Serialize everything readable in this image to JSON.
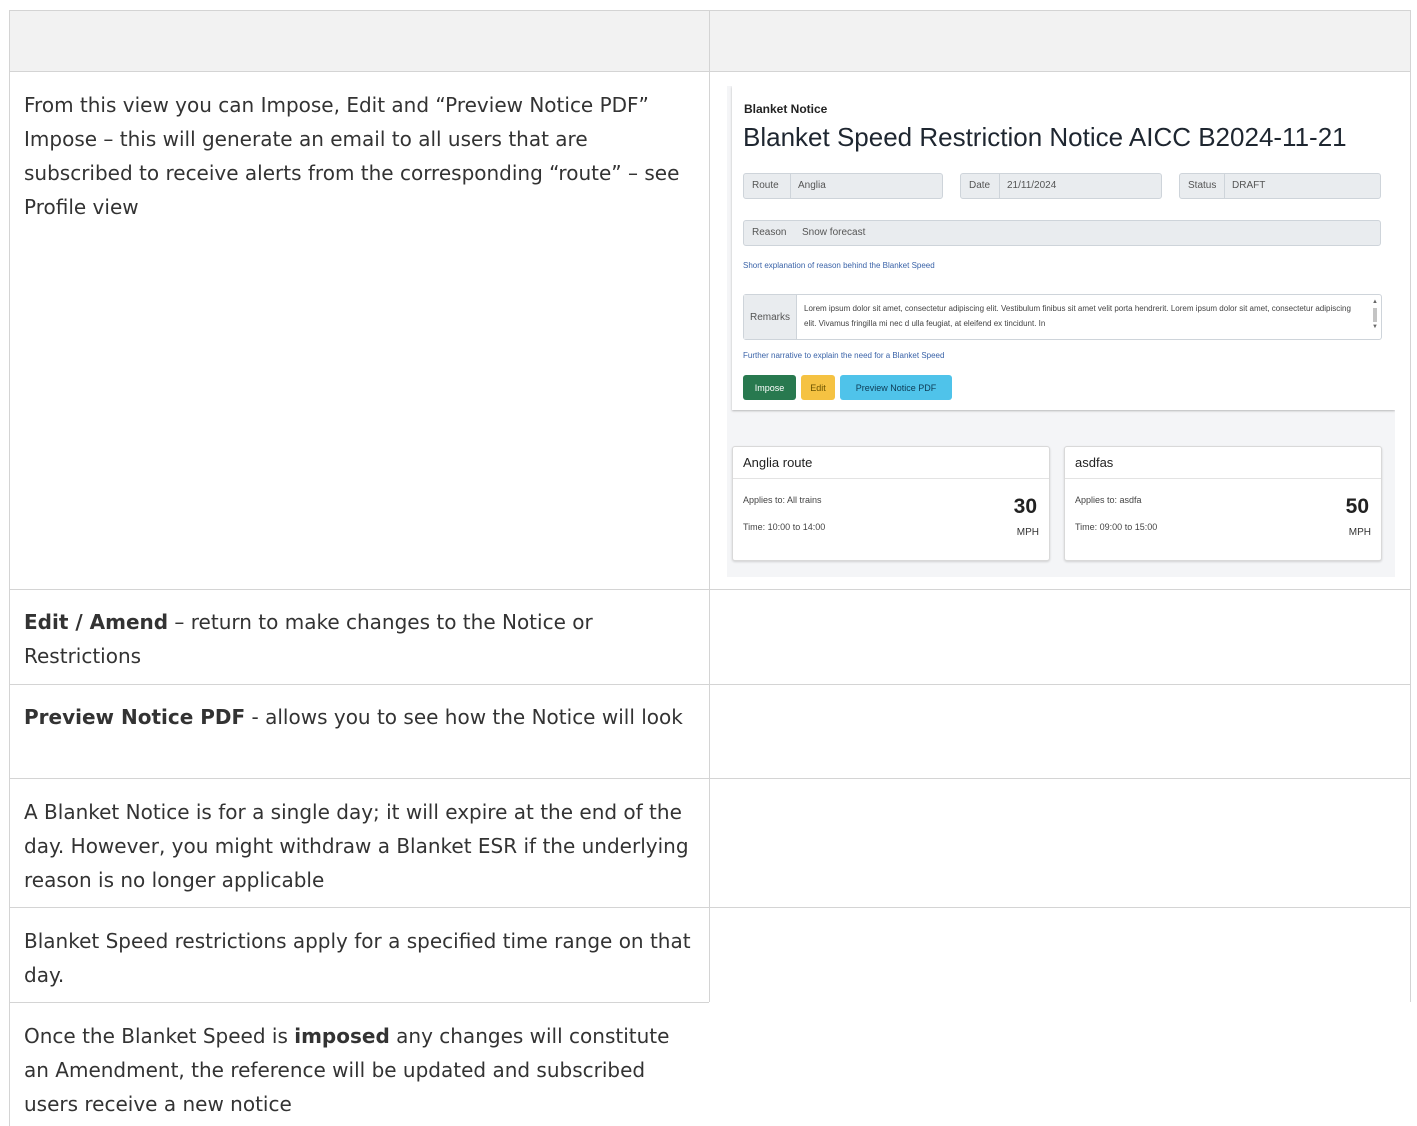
{
  "row1": {
    "text": "From this view you can Impose, Edit and “Preview Notice PDF” Impose – this will generate an email to all users that are subscribed to receive alerts from the corresponding “route” – see Profile view"
  },
  "row2": {
    "bold": "Edit / Amend",
    "rest": " – return to make changes to the Notice or Restrictions"
  },
  "row3": {
    "bold": "Preview Notice PDF",
    "rest": " - allows you to see how the Notice will look"
  },
  "row4": {
    "text": "A Blanket Notice is for a single day; it will expire at the end of the day. However, you might withdraw a Blanket ESR if the underlying reason is no longer applicable"
  },
  "row5": {
    "text": "Blanket Speed restrictions apply for a specified time range on that day."
  },
  "row6": {
    "pre": "Once the Blanket Speed is ",
    "bold": "imposed",
    "post": " any changes will constitute an Amendment, the reference will be updated and subscribed users receive a new notice"
  },
  "screenshot": {
    "breadcrumb": "Blanket Notice",
    "title": "Blanket Speed Restriction Notice AICC B2024-11-21",
    "route_label": "Route",
    "route_value": "Anglia",
    "date_label": "Date",
    "date_value": "21/11/2024",
    "status_label": "Status",
    "status_value": "DRAFT",
    "reason_label": "Reason",
    "reason_value": "Snow forecast",
    "reason_hint": "Short explanation of reason behind the Blanket Speed",
    "remarks_label": "Remarks",
    "remarks_text": "Lorem ipsum dolor sit amet, consectetur adipiscing elit. Vestibulum finibus sit amet velit porta hendrerit. Lorem ipsum dolor sit amet, consectetur adipiscing elit. Vivamus fringilla mi nec d ulla feugiat, at eleifend ex tincidunt. In",
    "remarks_hint": "Further narrative to explain the need for a Blanket Speed",
    "buttons": {
      "impose": "Impose",
      "edit": "Edit",
      "preview": "Preview Notice PDF"
    },
    "colors": {
      "impose": "#28794f",
      "edit": "#f5c242",
      "preview": "#4fc3ea"
    },
    "routes": [
      {
        "name": "Anglia route",
        "applies": "Applies to: All trains",
        "time": "Time: 10:00 to 14:00",
        "speed": "30",
        "unit": "MPH"
      },
      {
        "name": "asdfas",
        "applies": "Applies to: asdfa",
        "time": "Time: 09:00 to 15:00",
        "speed": "50",
        "unit": "MPH"
      }
    ]
  }
}
